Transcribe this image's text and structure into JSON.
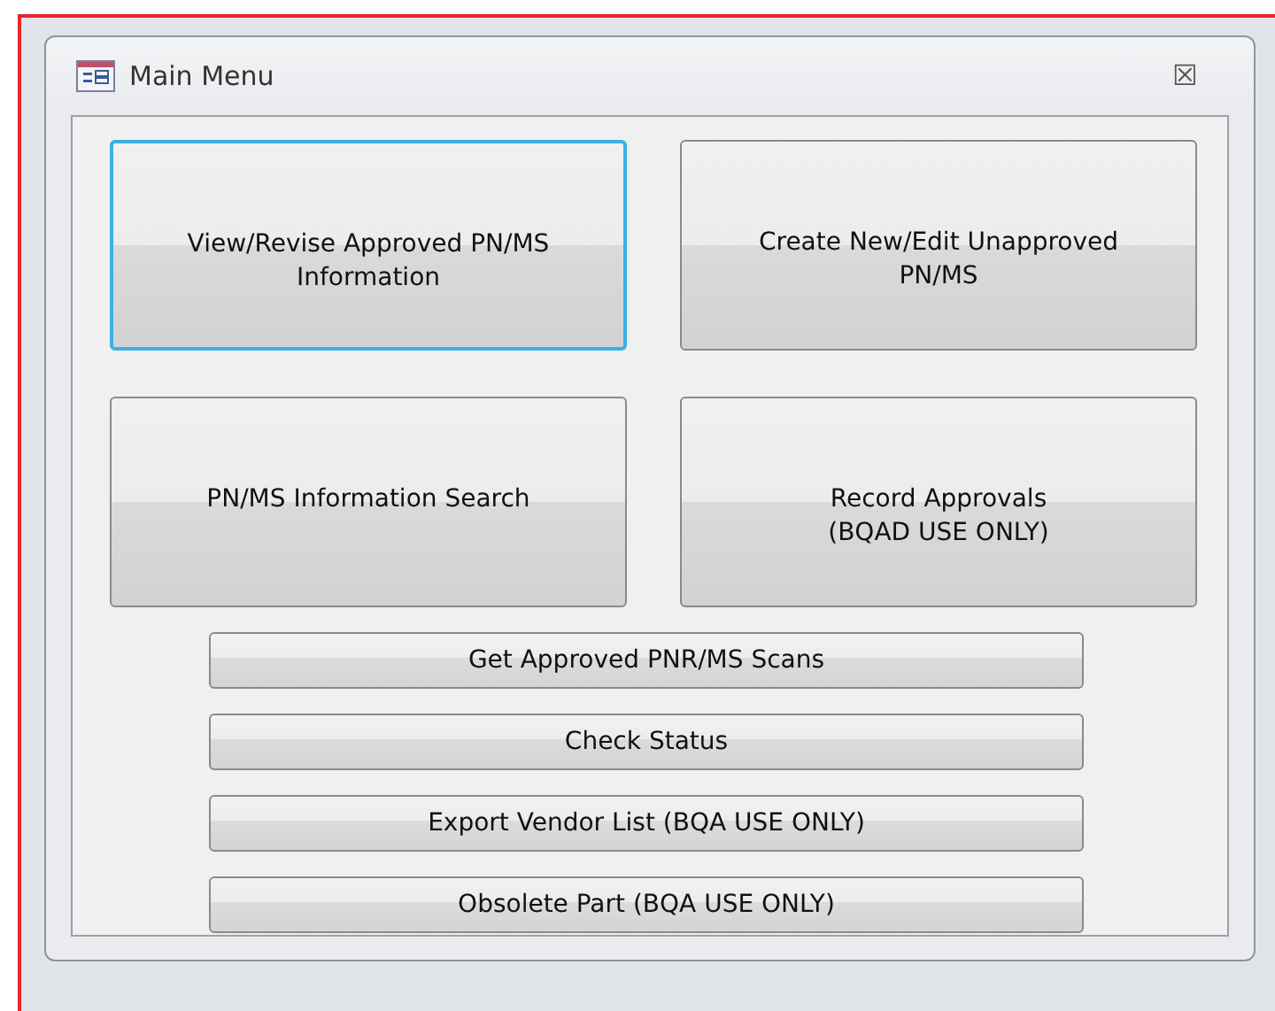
{
  "window": {
    "title": "Main Menu",
    "close": "☒"
  },
  "main_buttons": [
    {
      "lines": [
        "View/Revise Approved PN/MS",
        "Information"
      ],
      "selected": true
    },
    {
      "lines": [
        "Create New/Edit Unapproved",
        "PN/MS"
      ],
      "selected": false
    },
    {
      "lines": [
        "PN/MS Information Search"
      ],
      "selected": false
    },
    {
      "lines": [
        "Record Approvals",
        "(BQAD USE ONLY)"
      ],
      "selected": false
    }
  ],
  "buttons": [
    "Get Approved PNR/MS Scans",
    "Check Status",
    "Export Vendor List (BQA USE ONLY)",
    "Obsolete Part (BQA USE ONLY)"
  ]
}
